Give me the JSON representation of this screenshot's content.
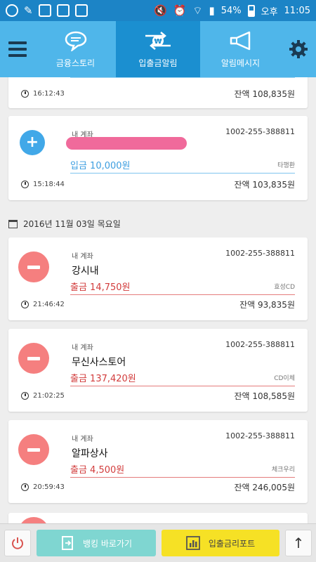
{
  "status_bar": {
    "battery": "54%",
    "ampm": "오후",
    "time": "11:05"
  },
  "top_nav": {
    "tabs": [
      {
        "label": "금융스토리",
        "icon": "speech-bubble-icon"
      },
      {
        "label": "입출금알림",
        "icon": "exchange-won-icon"
      },
      {
        "label": "알림메시지",
        "icon": "megaphone-icon"
      }
    ],
    "active_tab": 1
  },
  "transactions_top": [
    {
      "time": "16:12:43",
      "balance": "잔액 108,835원"
    },
    {
      "type": "deposit",
      "account_label": "내 계좌",
      "account_no": "1002-255-388811",
      "amount": "입금 10,000원",
      "bank": "타행환",
      "time": "15:18:44",
      "balance": "잔액 103,835원"
    }
  ],
  "date_header": "2016년 11월 03일 목요일",
  "transactions": [
    {
      "type": "withdraw",
      "account_label": "내 계좌",
      "account_no": "1002-255-388811",
      "merchant": "강시내",
      "amount": "출금 14,750원",
      "bank": "효성CD",
      "time": "21:46:42",
      "balance": "잔액 93,835원"
    },
    {
      "type": "withdraw",
      "account_label": "내 계좌",
      "account_no": "1002-255-388811",
      "merchant": "무신사스토어",
      "amount": "출금 137,420원",
      "bank": "CD이체",
      "time": "21:02:25",
      "balance": "잔액 108,585원"
    },
    {
      "type": "withdraw",
      "account_label": "내 계좌",
      "account_no": "1002-255-388811",
      "merchant": "알파상사",
      "amount": "출금 4,500원",
      "bank": "체크우리",
      "time": "20:59:43",
      "balance": "잔액 246,005원"
    }
  ],
  "bottom_bar": {
    "bank_shortcut": "뱅킹 바로가기",
    "report": "입출금리포트"
  },
  "colors": {
    "nav_bg": "#4fb6ea",
    "nav_active": "#1b8fd0",
    "deposit": "#3d9ee0",
    "withdraw": "#d23c3c",
    "bank_btn": "#7fd6d1",
    "report_btn": "#f6e125"
  }
}
